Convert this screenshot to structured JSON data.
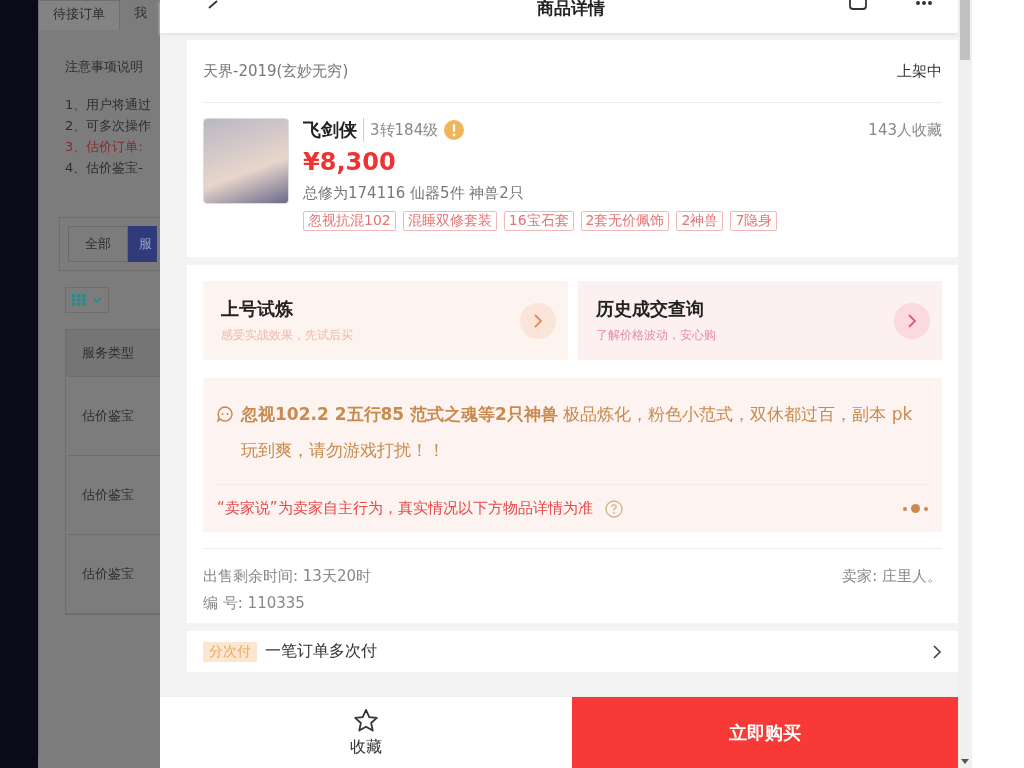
{
  "background_page": {
    "tabs": [
      {
        "label": "待接订单",
        "selected": true
      },
      {
        "label": "我",
        "selected": false
      }
    ],
    "notice_title": "注意事项说明",
    "notice_items": [
      {
        "text": "1、用户将通过",
        "kind": "normal"
      },
      {
        "text": "2、可多次操作",
        "kind": "normal"
      },
      {
        "text": "3、估价订单:",
        "kind": "warning"
      },
      {
        "text": "4、估价鉴宝-",
        "kind": "normal"
      }
    ],
    "filters": [
      {
        "label": "全部",
        "selected": false
      },
      {
        "label": "服",
        "selected": true
      }
    ],
    "table": {
      "columns": [
        "服务类型"
      ],
      "rows": [
        [
          "估价鉴宝"
        ],
        [
          "估价鉴宝"
        ],
        [
          "估价鉴宝"
        ]
      ]
    }
  },
  "modal": {
    "title": "商品详情",
    "server": "天界-2019(玄妙无穷)",
    "status": "上架中",
    "product": {
      "name": "飞剑侠",
      "level": "3转184级",
      "favorites": "143人收藏",
      "price": "¥8,300",
      "stats": "总修为174116  仙器5件  神兽2只",
      "tags": [
        "忽视抗混102",
        "混睡双修套装",
        "16宝石套",
        "2套无价佩饰",
        "2神兽",
        "7隐身"
      ]
    },
    "actions": [
      {
        "title": "上号试炼",
        "subtitle": "感受实战效果，先试后买",
        "kind": "trial"
      },
      {
        "title": "历史成交查询",
        "subtitle": "了解价格波动，安心购",
        "kind": "history"
      }
    ],
    "seller_says": {
      "text": "**忽视102.2 2五行85 范式之魂等2只神兽** 极品炼化，粉色小范式，双休都过百，副本 pk 玩到爽，请勿游戏打扰！！",
      "disclaimer": "“卖家说”为卖家自主行为，真实情况以下方物品详情为准",
      "pager": [
        {
          "selected": false
        },
        {
          "selected": true
        },
        {
          "selected": false
        }
      ]
    },
    "remaining_time": "出售剩余时间: 13天20时",
    "seller": "卖家: 庄里人。",
    "serial": "编 号: 110335",
    "installment": {
      "tag": "分次付",
      "text": "一笔订单多次付"
    },
    "bottom_bar": {
      "favorite": "收藏",
      "buy": "立即购买"
    }
  }
}
